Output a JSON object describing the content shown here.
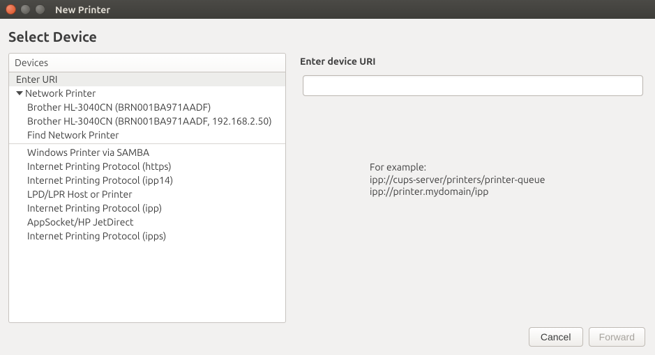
{
  "window": {
    "title": "New Printer"
  },
  "heading": "Select Device",
  "devices_header": "Devices",
  "devices": {
    "enter_uri": "Enter URI",
    "network_printer": "Network Printer",
    "children": [
      "Brother HL-3040CN (BRN001BA971AADF)",
      "Brother HL-3040CN (BRN001BA971AADF, 192.168.2.50)",
      "Find Network Printer"
    ],
    "protocols": [
      "Windows Printer via SAMBA",
      "Internet Printing Protocol (https)",
      "Internet Printing Protocol (ipp14)",
      "LPD/LPR Host or Printer",
      "Internet Printing Protocol (ipp)",
      "AppSocket/HP JetDirect",
      "Internet Printing Protocol (ipps)"
    ]
  },
  "right": {
    "heading": "Enter device URI",
    "uri_value": "",
    "example_label": "For example:",
    "example_line1": "ipp://cups-server/printers/printer-queue",
    "example_line2": "ipp://printer.mydomain/ipp"
  },
  "buttons": {
    "cancel": "Cancel",
    "forward": "Forward"
  }
}
